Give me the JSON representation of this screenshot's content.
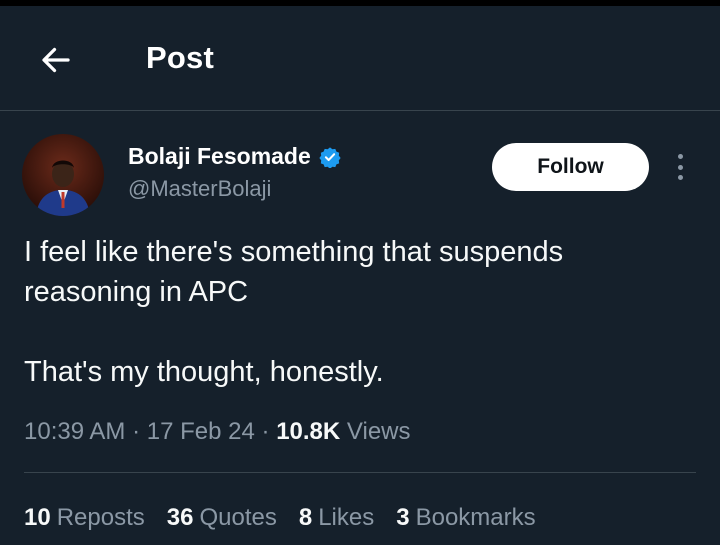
{
  "header": {
    "back_icon": "arrow-left-icon",
    "title": "Post"
  },
  "author": {
    "display_name": "Bolaji Fesomade",
    "handle": "@MasterBolaji",
    "verified_icon": "verified-badge-icon",
    "verified_color": "#1d9bf0"
  },
  "actions": {
    "follow_label": "Follow",
    "more_icon": "more-vertical-icon"
  },
  "tweet": {
    "line1": "I feel like there's something that suspends",
    "line2": "reasoning in APC",
    "line3": "That's my thought, honestly."
  },
  "meta": {
    "time": "10:39 AM",
    "separator": "·",
    "date": "17 Feb 24",
    "views_count": "10.8K",
    "views_label": "Views"
  },
  "stats": {
    "reposts_count": "10",
    "reposts_label": "Reposts",
    "quotes_count": "36",
    "quotes_label": "Quotes",
    "likes_count": "8",
    "likes_label": "Likes",
    "bookmarks_count": "3",
    "bookmarks_label": "Bookmarks"
  },
  "colors": {
    "background": "#15202b",
    "secondary_text": "#8b98a5",
    "divider": "#38444d"
  }
}
